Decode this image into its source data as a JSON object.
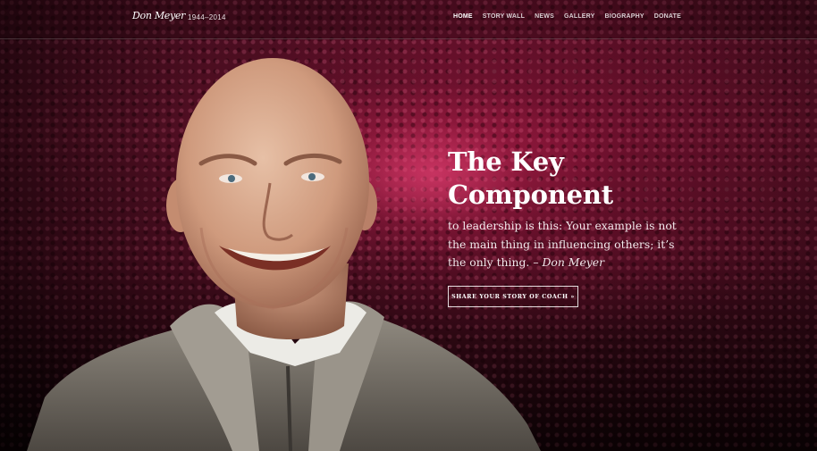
{
  "header": {
    "logo_text": "Don Meyer",
    "years": "1944–2014"
  },
  "nav": {
    "items": [
      {
        "label": "HOME",
        "active": true
      },
      {
        "label": "STORY WALL"
      },
      {
        "label": "NEWS"
      },
      {
        "label": "GALLERY"
      },
      {
        "label": "BIOGRAPHY"
      },
      {
        "label": "DONATE"
      }
    ]
  },
  "hero": {
    "heading": "The Key Component",
    "quote_text": "to leadership is this: Your example is not the main thing in influencing others; it’s the only thing.",
    "attribution": "– Don Meyer",
    "cta_label": "SHARE YOUR STORY OF COACH »"
  },
  "colors": {
    "tint": "#5e1128",
    "text": "#ffffff"
  }
}
